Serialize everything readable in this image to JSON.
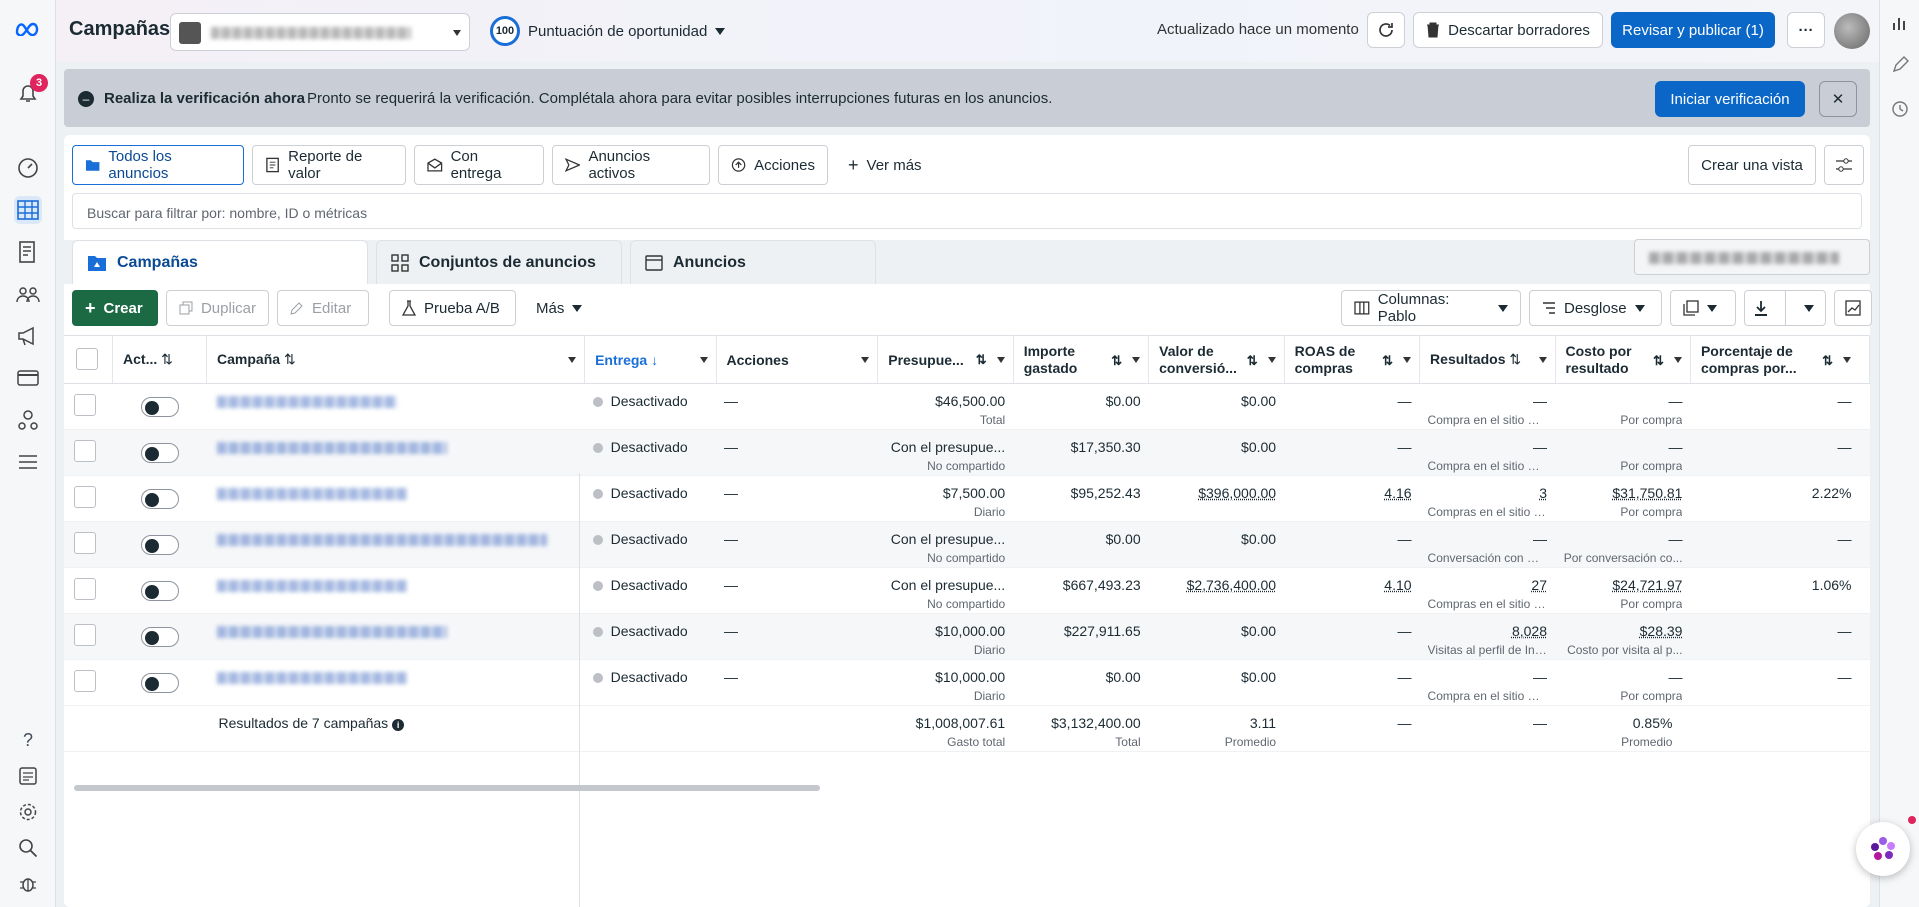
{
  "app": {
    "title": "Campañas"
  },
  "header": {
    "score_value": "100",
    "score_label": "Puntuación de oportunidad",
    "updated": "Actualizado hace un momento",
    "discard_label": "Descartar borradores",
    "publish_label": "Revisar y publicar (1)",
    "more_label": "···"
  },
  "notifications": {
    "count": "3"
  },
  "banner": {
    "title": "Realiza la verificación ahora",
    "message": "Pronto se requerirá la verificación. Complétala ahora para evitar posibles interrupciones futuras en los anuncios.",
    "action_label": "Iniciar verificación",
    "close_label": "✕"
  },
  "views": {
    "items": [
      "Todos los anuncios",
      "Reporte de valor",
      "Con entrega",
      "Anuncios activos",
      "Acciones",
      "Ver más"
    ],
    "create_view_label": "Crear una vista"
  },
  "search": {
    "placeholder": "Buscar para filtrar por: nombre, ID o métricas"
  },
  "tabs": [
    "Campañas",
    "Conjuntos de anuncios",
    "Anuncios"
  ],
  "toolbar": {
    "create": "Crear",
    "duplicate": "Duplicar",
    "edit": "Editar",
    "ab_test": "Prueba A/B",
    "more": "Más",
    "columns": "Columnas: Pablo",
    "breakdown": "Desglose"
  },
  "table": {
    "headers": {
      "active": "Act...",
      "campaign": "Campaña",
      "delivery": "Entrega",
      "actions": "Acciones",
      "budget": "Presupue...",
      "spent": "Importe gastado",
      "conv_value": "Valor de conversió...",
      "roas": "ROAS de compras",
      "results": "Resultados",
      "cost_result": "Costo por resultado",
      "purchase_pct": "Porcentaje de compras por..."
    },
    "rows": [
      {
        "delivery": "Desactivado",
        "actions": "—",
        "budget": "$46,500.00",
        "budget_sub": "Total",
        "spent": "$0.00",
        "conv_value": "$0.00",
        "roas": "—",
        "results": "—",
        "results_sub": "Compra en el sitio web",
        "cost": "—",
        "cost_sub": "Por compra",
        "pct": "—"
      },
      {
        "delivery": "Desactivado",
        "actions": "—",
        "budget": "Con el presupue...",
        "budget_sub": "No compartido",
        "spent": "$17,350.30",
        "conv_value": "$0.00",
        "roas": "—",
        "results": "—",
        "results_sub": "Compra en el sitio web",
        "cost": "—",
        "cost_sub": "Por compra",
        "pct": "—"
      },
      {
        "delivery": "Desactivado",
        "actions": "—",
        "budget": "$7,500.00",
        "budget_sub": "Diario",
        "spent": "$95,252.43",
        "conv_value": "$396,000.00",
        "roas": "4.16",
        "results": "3",
        "results_sub": "Compras en el sitio web",
        "cost": "$31,750.81",
        "cost_sub": "Por compra",
        "pct": "2.22%"
      },
      {
        "delivery": "Desactivado",
        "actions": "—",
        "budget": "Con el presupue...",
        "budget_sub": "No compartido",
        "spent": "$0.00",
        "conv_value": "$0.00",
        "roas": "—",
        "results": "—",
        "results_sub": "Conversación con mensaj...",
        "cost": "—",
        "cost_sub": "Por conversación co...",
        "pct": "—"
      },
      {
        "delivery": "Desactivado",
        "actions": "—",
        "budget": "Con el presupue...",
        "budget_sub": "No compartido",
        "spent": "$667,493.23",
        "conv_value": "$2,736,400.00",
        "roas": "4.10",
        "results": "27",
        "results_sub": "Compras en el sitio web",
        "cost": "$24,721.97",
        "cost_sub": "Por compra",
        "pct": "1.06%"
      },
      {
        "delivery": "Desactivado",
        "actions": "—",
        "budget": "$10,000.00",
        "budget_sub": "Diario",
        "spent": "$227,911.65",
        "conv_value": "$0.00",
        "roas": "—",
        "results": "8,028",
        "results_sub": "Visitas al perfil de Instagr...",
        "cost": "$28.39",
        "cost_sub": "Costo por visita al p...",
        "pct": "—"
      },
      {
        "delivery": "Desactivado",
        "actions": "—",
        "budget": "$10,000.00",
        "budget_sub": "Diario",
        "spent": "$0.00",
        "conv_value": "$0.00",
        "roas": "—",
        "results": "—",
        "results_sub": "Compra en el sitio web",
        "cost": "—",
        "cost_sub": "Por compra",
        "pct": "—"
      }
    ],
    "footer": {
      "label": "Resultados de 7 campañas",
      "spent": "$1,008,007.61",
      "spent_sub": "Gasto total",
      "conv_value": "$3,132,400.00",
      "conv_sub": "Total",
      "roas": "3.11",
      "roas_sub": "Promedio",
      "results": "—",
      "cost": "—",
      "pct": "0.85%",
      "pct_sub": "Promedio"
    }
  },
  "colors": {
    "accent": "#0a67c8",
    "create": "#1b6a43",
    "badge": "#e0245e"
  }
}
